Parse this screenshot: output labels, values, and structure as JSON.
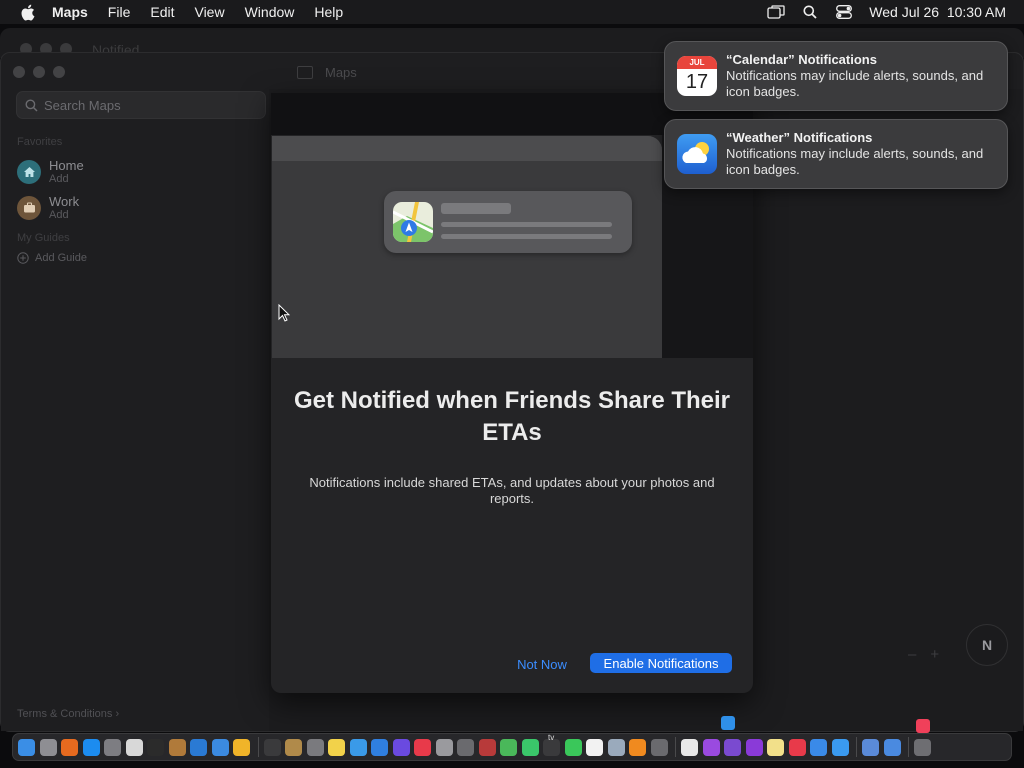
{
  "menubar": {
    "apple_icon": "apple-logo-icon",
    "app_name": "Maps",
    "items": [
      "File",
      "Edit",
      "View",
      "Window",
      "Help"
    ],
    "status_icons": [
      "screen-mirroring-icon",
      "spotlight-search-icon",
      "control-center-icon"
    ],
    "datetime": "Wed Jul 26  10:30 AM"
  },
  "background_window": {
    "title": "Notified"
  },
  "window": {
    "title": "Maps",
    "sidebar": {
      "search_placeholder": "Search Maps",
      "favorites_label": "Favorites",
      "favorites": [
        {
          "name": "Home",
          "sub": "Add",
          "icon": "house-icon",
          "color": "#2d7d8a"
        },
        {
          "name": "Work",
          "sub": "Add",
          "icon": "briefcase-icon",
          "color": "#7a5a3a"
        }
      ],
      "guides_label": "My Guides",
      "add_guide": "Add Guide",
      "terms": "Terms & Conditions",
      "terms_chevron": "›"
    },
    "map_controls": {
      "zoom_out": "–",
      "zoom_in": "+",
      "compass": "N"
    }
  },
  "modal": {
    "title": "Get Notified when Friends Share Their ETAs",
    "body": "Notifications include shared ETAs, and updates about your photos and reports.",
    "secondary_button": "Not Now",
    "primary_button": "Enable Notifications",
    "accent_color": "#1f6ee6",
    "illustration_app_icon": "maps-app-icon"
  },
  "notifications": [
    {
      "title": "“Calendar” Notifications",
      "body": "Notifications may include alerts, sounds, and icon badges.",
      "icon": "calendar-icon",
      "icon_month": "JUL",
      "icon_day": "17"
    },
    {
      "title": "“Weather” Notifications",
      "body": "Notifications may include alerts, sounds, and icon badges.",
      "icon": "weather-icon"
    }
  ],
  "dock": {
    "apps": [
      {
        "name": "finder-icon",
        "color": "#3a8ee6"
      },
      {
        "name": "launchpad-icon",
        "color": "#8e8e93"
      },
      {
        "name": "firefox-icon",
        "color": "#e66a1f"
      },
      {
        "name": "app-store-icon",
        "color": "#1c8cf0"
      },
      {
        "name": "system-settings-icon",
        "color": "#7d7d82"
      },
      {
        "name": "textedit-icon",
        "color": "#d8d8d8"
      },
      {
        "name": "terminal-icon",
        "color": "#2b2b2b"
      },
      {
        "name": "script-editor-icon",
        "color": "#b07a3a"
      },
      {
        "name": "vscode-icon",
        "color": "#2a7ad4"
      },
      {
        "name": "xcode-icon",
        "color": "#3b8ae0"
      },
      {
        "name": "sketch-icon",
        "color": "#f0b429"
      },
      {
        "name": "separator",
        "color": ""
      },
      {
        "name": "screen-recorder-icon",
        "color": "#3a3a3c"
      },
      {
        "name": "archive-utility-icon",
        "color": "#b08a4a"
      },
      {
        "name": "photo-booth-icon",
        "color": "#7a7a7e"
      },
      {
        "name": "notes-icon",
        "color": "#f2d24a"
      },
      {
        "name": "icloud-drive-icon",
        "color": "#3a9ae8"
      },
      {
        "name": "safari-icon",
        "color": "#2f7fe0"
      },
      {
        "name": "shortcuts-icon",
        "color": "#6a4ae0"
      },
      {
        "name": "news-icon",
        "color": "#e83a4a"
      },
      {
        "name": "font-book-icon",
        "color": "#9a9a9e"
      },
      {
        "name": "chess-icon",
        "color": "#6a6a6e"
      },
      {
        "name": "dictionary-icon",
        "color": "#b83a3a"
      },
      {
        "name": "maps-icon",
        "color": "#4ab85a"
      },
      {
        "name": "find-my-icon",
        "color": "#3ac76a"
      },
      {
        "name": "stocks-icon",
        "color": "#3a3a3c"
      },
      {
        "name": "messages-icon",
        "color": "#3ac75a"
      },
      {
        "name": "calendar-icon",
        "color": "#f2f2f2"
      },
      {
        "name": "preview-icon",
        "color": "#9aaabc"
      },
      {
        "name": "books-icon",
        "color": "#f08a1f"
      },
      {
        "name": "calculator-icon",
        "color": "#6a6a6e"
      },
      {
        "name": "separator",
        "color": ""
      },
      {
        "name": "clock-icon",
        "color": "#e8e8e8"
      },
      {
        "name": "podcasts-icon",
        "color": "#9a4ae0"
      },
      {
        "name": "visual-studio-icon",
        "color": "#7a4ad0"
      },
      {
        "name": "podcasts-alt-icon",
        "color": "#8a3ad8"
      },
      {
        "name": "stickies-icon",
        "color": "#f2e08a"
      },
      {
        "name": "photos-icon",
        "color": "#e83a4a"
      },
      {
        "name": "quicktime-icon",
        "color": "#3a8ae8"
      },
      {
        "name": "mail-icon",
        "color": "#3a9af0"
      },
      {
        "name": "separator",
        "color": ""
      },
      {
        "name": "xcode-alt-icon",
        "color": "#5a8ad8"
      },
      {
        "name": "migration-icon",
        "color": "#4a8ae0"
      },
      {
        "name": "separator",
        "color": ""
      },
      {
        "name": "trash-icon",
        "color": "#6e6e72"
      }
    ],
    "floating": [
      {
        "name": "app-store-bounce-icon",
        "color": "#2f8fe8"
      },
      {
        "name": "music-bounce-icon",
        "color": "#f0405a"
      },
      {
        "name": "apple-tv-label",
        "label": "tv"
      }
    ]
  }
}
